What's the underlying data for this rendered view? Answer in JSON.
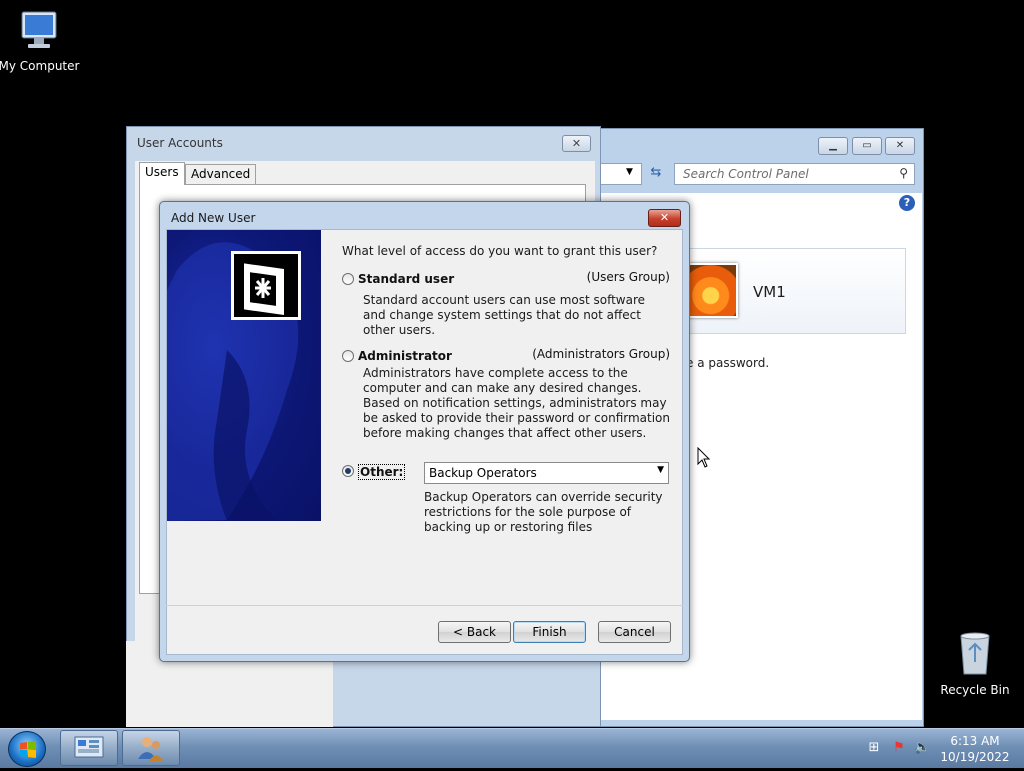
{
  "desktop": {
    "my_computer": "My Computer",
    "recycle_bin": "Recycle Bin"
  },
  "control_panel": {
    "search_placeholder": "Search Control Panel",
    "user_name": "VM1",
    "password_text": "e a password."
  },
  "user_accounts": {
    "title": "User Accounts",
    "tabs": [
      "Users",
      "Advanced"
    ]
  },
  "dialog": {
    "title": "Add New User",
    "question": "What level of access do you want to grant this user?",
    "options": [
      {
        "label": "Standard user",
        "group": "(Users Group)",
        "description": "Standard account users can use most software and change system settings that do not affect other users.",
        "selected": false
      },
      {
        "label": "Administrator",
        "group": "(Administrators Group)",
        "description": "Administrators have complete access to the computer and can make any desired changes. Based on notification settings, administrators may be asked to provide their password or confirmation before making changes that affect other users.",
        "selected": false
      },
      {
        "label": "Other:",
        "selected": true,
        "combo_value": "Backup Operators",
        "description": "Backup Operators can override security restrictions for the sole purpose of backing up or restoring files"
      }
    ],
    "buttons": {
      "back": "< Back",
      "finish": "Finish",
      "cancel": "Cancel"
    }
  },
  "taskbar": {
    "time": "6:13 AM",
    "date": "10/19/2022"
  },
  "colors": {
    "banner": "#0d1878",
    "titlebar": "#c3d6ec",
    "close_button": "#c5412d"
  }
}
